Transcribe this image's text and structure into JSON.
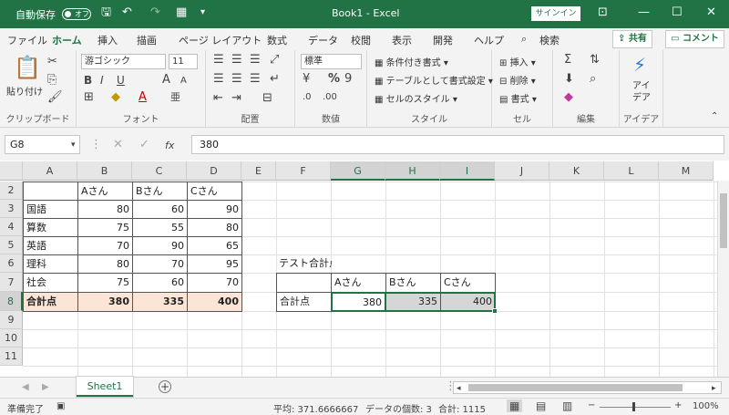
{
  "titlebar": {
    "autosave_label": "自動保存",
    "autosave_state": "オフ",
    "title": "Book1  -  Excel",
    "signin": "サインイン",
    "min_icon": "minimize-icon",
    "colors": {
      "bar": "#217346"
    }
  },
  "ribbon_tabs": [
    "ファイル",
    "ホーム",
    "挿入",
    "描画",
    "ページ レイアウト",
    "数式",
    "データ",
    "校閲",
    "表示",
    "開発",
    "ヘルプ"
  ],
  "search_label": "検索",
  "share_label": "共有",
  "comment_label": "コメント",
  "ribbon": {
    "clipboard": {
      "paste": "貼り付け",
      "label": "クリップボード"
    },
    "font": {
      "name": "游ゴシック",
      "size": "11",
      "label": "フォント",
      "bold": "B",
      "italic": "I",
      "underline": "U"
    },
    "alignment": {
      "label": "配置"
    },
    "number": {
      "format": "標準",
      "label": "数値",
      "percent": "%"
    },
    "styles": {
      "cond": "条件付き書式",
      "table": "テーブルとして書式設定",
      "cell": "セルのスタイル",
      "label": "スタイル"
    },
    "cells": {
      "insert": "挿入",
      "delete": "削除",
      "format": "書式",
      "label": "セル"
    },
    "editing": {
      "label": "編集"
    },
    "ideas": {
      "name": "アイ\nデア",
      "line1": "アイ",
      "line2": "デア",
      "label": "アイデア"
    }
  },
  "formula_bar": {
    "namebox": "G8",
    "fx": "fx",
    "value": "380"
  },
  "columns": [
    "A",
    "B",
    "C",
    "D",
    "E",
    "F",
    "G",
    "H",
    "I",
    "J",
    "K",
    "L",
    "M"
  ],
  "rows": [
    "1",
    "2",
    "3",
    "4",
    "5",
    "6",
    "7",
    "8",
    "9",
    "10",
    "11"
  ],
  "table1": {
    "headers": [
      "Aさん",
      "Bさん",
      "Cさん"
    ],
    "rows": [
      {
        "subject": "国語",
        "values": [
          "80",
          "60",
          "90"
        ]
      },
      {
        "subject": "算数",
        "values": [
          "75",
          "55",
          "80"
        ]
      },
      {
        "subject": "英語",
        "values": [
          "70",
          "90",
          "65"
        ]
      },
      {
        "subject": "理科",
        "values": [
          "80",
          "70",
          "95"
        ]
      },
      {
        "subject": "社会",
        "values": [
          "75",
          "60",
          "70"
        ]
      }
    ],
    "total": {
      "label": "合計点",
      "values": [
        "380",
        "335",
        "400"
      ]
    }
  },
  "table2": {
    "title": "テスト合計点",
    "headers": [
      "Aさん",
      "Bさん",
      "Cさん"
    ],
    "row_label": "合計点",
    "values": [
      "380",
      "335",
      "400"
    ]
  },
  "sheet_tabs": {
    "active": "Sheet1",
    "add": "+"
  },
  "status": {
    "ready": "準備完了",
    "average": "平均: 371.6666667",
    "count": "データの個数: 3",
    "sum": "合計: 1115",
    "zoom": "100%"
  }
}
